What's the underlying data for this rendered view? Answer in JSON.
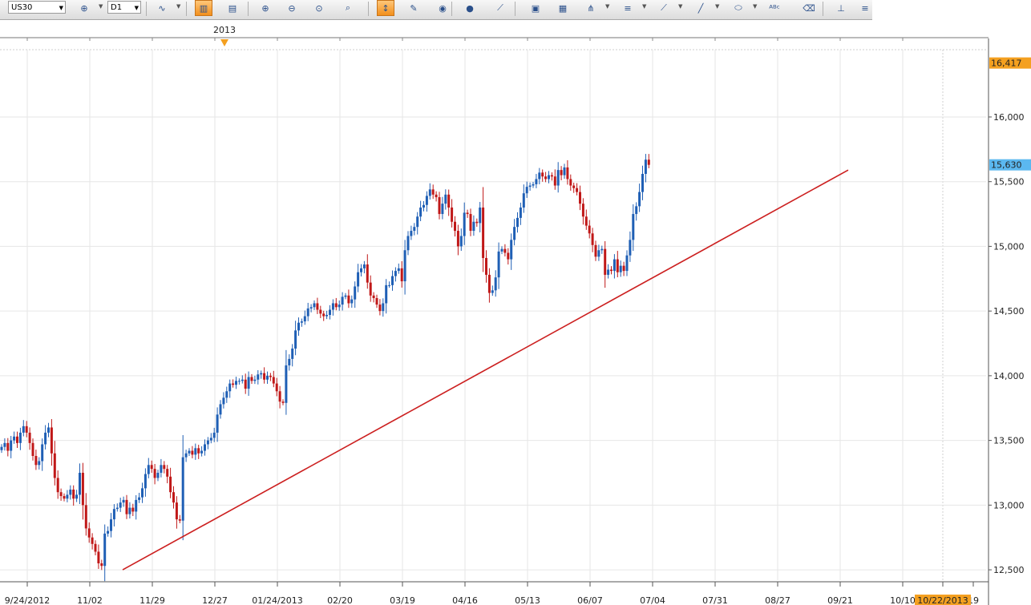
{
  "toolbar": {
    "symbol": "US30",
    "timeframe": "D1",
    "buttons": [
      {
        "name": "crosshair-icon",
        "glyph": "⊕",
        "active": false,
        "dropdown": true
      },
      {
        "name": "indicators-icon",
        "glyph": "∿",
        "active": false,
        "dropdown": true
      },
      {
        "name": "candles-icon",
        "glyph": "▥",
        "active": true,
        "dropdown": false
      },
      {
        "name": "bars-icon",
        "glyph": "▤",
        "active": false,
        "dropdown": false
      },
      {
        "name": "zoom-in-icon",
        "glyph": "⊕",
        "active": false,
        "dropdown": false
      },
      {
        "name": "zoom-out-icon",
        "glyph": "⊖",
        "active": false,
        "dropdown": false
      },
      {
        "name": "zoom-fit-icon",
        "glyph": "⊙",
        "active": false,
        "dropdown": false
      },
      {
        "name": "zoom-box-icon",
        "glyph": "⌕",
        "active": false,
        "dropdown": false
      },
      {
        "name": "autoscale-icon",
        "glyph": "↕",
        "active": true,
        "dropdown": false
      },
      {
        "name": "marker-icon",
        "glyph": "✎",
        "active": false,
        "dropdown": false
      },
      {
        "name": "eye-icon",
        "glyph": "◉",
        "active": false,
        "dropdown": false
      },
      {
        "name": "globe-icon",
        "glyph": "●",
        "active": false,
        "dropdown": false
      },
      {
        "name": "ruler-icon",
        "glyph": "⟋",
        "active": false,
        "dropdown": false
      },
      {
        "name": "picture-icon",
        "glyph": "▣",
        "active": false,
        "dropdown": false
      },
      {
        "name": "chart-window-icon",
        "glyph": "▦",
        "active": false,
        "dropdown": false
      },
      {
        "name": "fork-icon",
        "glyph": "⋔",
        "active": false,
        "dropdown": true
      },
      {
        "name": "lines-icon",
        "glyph": "≡",
        "active": false,
        "dropdown": true
      },
      {
        "name": "fan-icon",
        "glyph": "⟋",
        "active": false,
        "dropdown": true
      },
      {
        "name": "pen-icon",
        "glyph": "╱",
        "active": false,
        "dropdown": true
      },
      {
        "name": "ellipse-icon",
        "glyph": "⬭",
        "active": false,
        "dropdown": true
      },
      {
        "name": "text-icon",
        "glyph": "ᴬᴮᶜ",
        "active": false,
        "dropdown": false
      },
      {
        "name": "eraser-icon",
        "glyph": "⌫",
        "active": false,
        "dropdown": false
      },
      {
        "name": "hierarchy-icon",
        "glyph": "⊥",
        "active": false,
        "dropdown": false
      },
      {
        "name": "menu-icon",
        "glyph": "≡",
        "active": false,
        "dropdown": false
      }
    ]
  },
  "chart_data": {
    "type": "candlestick",
    "symbol": "US30",
    "timeframe": "D1",
    "title": "",
    "xlabel": "",
    "ylabel": "",
    "ylim": [
      12420,
      16520
    ],
    "y_ticks": [
      "12,500",
      "13,000",
      "13,500",
      "14,000",
      "14,500",
      "15,000",
      "15,500",
      "16,000"
    ],
    "x_ticks": [
      "9/24/2012",
      "11/02",
      "11/29",
      "12/27",
      "01/24/2013",
      "02/20",
      "03/19",
      "04/16",
      "05/13",
      "06/07",
      "07/04",
      "07/31",
      "08/27",
      "09/21",
      "10/10",
      "10/22/2013",
      "19"
    ],
    "year_marker": "2013",
    "current_price_label": "15,630",
    "top_price_label": "16,417",
    "cursor_date_label": "10/22/2013",
    "trendline": {
      "from": {
        "date": "11/16/2012",
        "price": 12500
      },
      "to": {
        "date": "09/23/2013",
        "price": 15590
      },
      "color": "#cc1f1f"
    },
    "colors": {
      "up": "#1f5fb5",
      "down": "#c01818",
      "grid": "#e6e6e6",
      "current_price_bg": "#5bb8f0",
      "top_price_bg": "#f4a020",
      "cursor_date_bg": "#f4a020"
    },
    "closes": [
      13450,
      13480,
      13420,
      13500,
      13530,
      13480,
      13560,
      13610,
      13560,
      13480,
      13380,
      13310,
      13340,
      13470,
      13560,
      13600,
      13400,
      13210,
      13100,
      13070,
      13050,
      13080,
      13120,
      13050,
      13080,
      13250,
      13000,
      12820,
      12750,
      12700,
      12640,
      12550,
      12530,
      12780,
      12800,
      12890,
      12970,
      12980,
      13020,
      13040,
      12930,
      12980,
      12950,
      13040,
      13060,
      13130,
      13240,
      13310,
      13280,
      13210,
      13250,
      13310,
      13280,
      13220,
      13100,
      13020,
      12890,
      12880,
      13370,
      13400,
      13420,
      13390,
      13440,
      13400,
      13420,
      13470,
      13500,
      13520,
      13560,
      13700,
      13780,
      13830,
      13880,
      13940,
      13930,
      13960,
      13960,
      13970,
      13900,
      13990,
      13960,
      13970,
      14010,
      14020,
      13970,
      14000,
      13990,
      13940,
      13880,
      13800,
      13790,
      14080,
      14130,
      14210,
      14350,
      14410,
      14420,
      14460,
      14520,
      14530,
      14560,
      14510,
      14480,
      14460,
      14470,
      14510,
      14560,
      14530,
      14550,
      14610,
      14620,
      14560,
      14590,
      14690,
      14800,
      14830,
      14860,
      14720,
      14620,
      14600,
      14550,
      14500,
      14560,
      14700,
      14700,
      14770,
      14810,
      14830,
      14730,
      14970,
      15080,
      15120,
      15150,
      15230,
      15300,
      15320,
      15390,
      15440,
      15400,
      15380,
      15250,
      15330,
      15400,
      15300,
      15190,
      15120,
      15000,
      15080,
      15260,
      15250,
      15120,
      15190,
      15180,
      15300,
      14910,
      14780,
      14640,
      14660,
      14760,
      14960,
      14980,
      14950,
      14900,
      15050,
      15150,
      15220,
      15300,
      15410,
      15460,
      15470,
      15480,
      15520,
      15570,
      15540,
      15520,
      15550,
      15540,
      15470,
      15590,
      15550,
      15610,
      15520,
      15470,
      15450,
      15420,
      15330,
      15230,
      15160,
      15100,
      15010,
      14920,
      14970,
      14980,
      14780,
      14820,
      14810,
      14900,
      14800,
      14850,
      14810,
      14930,
      15050,
      15250,
      15310,
      15420,
      15560,
      15670,
      15630
    ],
    "dates_shown_by_grid": true
  }
}
